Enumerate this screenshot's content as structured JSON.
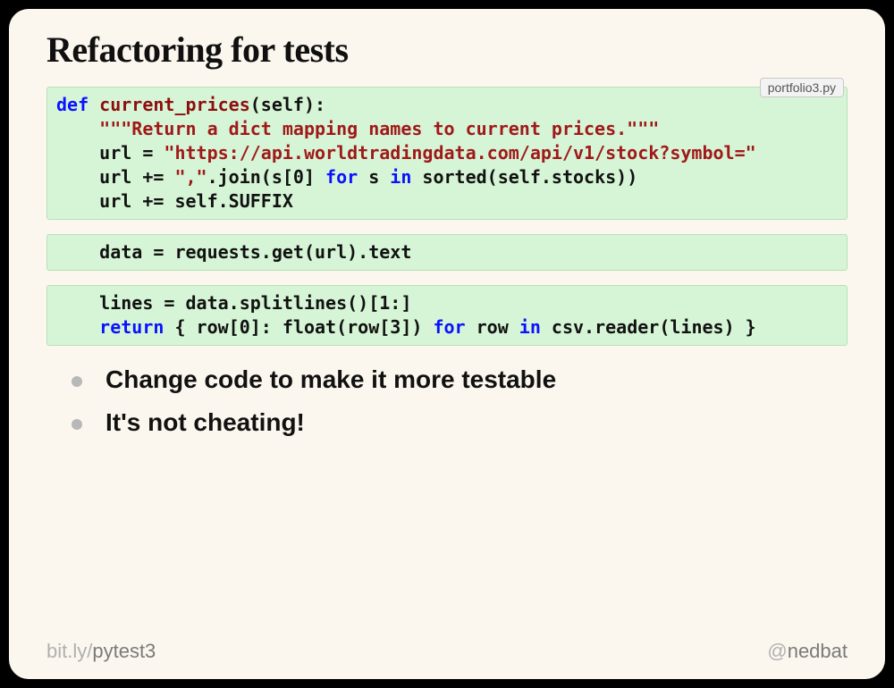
{
  "title": "Refactoring for tests",
  "file_badge": "portfolio3.py",
  "code": {
    "block1_html": "<span class=\"kw\">def</span> <span class=\"fn\">current_prices</span><span class=\"bold\">(self):</span>\n    <span class=\"str\">\"\"\"Return a dict mapping names to current prices.\"\"\"</span>\n    <span class=\"bold\">url = </span><span class=\"str\">\"https://api.worldtradingdata.com/api/v1/stock?symbol=\"</span>\n    <span class=\"bold\">url += </span><span class=\"str\">\",\"</span><span class=\"bold\">.join(s[0] </span><span class=\"kw\">for</span><span class=\"bold\"> s </span><span class=\"kw\">in</span><span class=\"bold\"> sorted(self.stocks))</span>\n    <span class=\"bold\">url += self.SUFFIX</span>",
    "block2_html": "    <span class=\"bold\">data = requests.get(url).text</span>",
    "block3_html": "    <span class=\"bold\">lines = data.splitlines()[1:]</span>\n    <span class=\"kw\">return</span><span class=\"bold\"> { row[0]: float(row[3]) </span><span class=\"kw\">for</span><span class=\"bold\"> row </span><span class=\"kw\">in</span><span class=\"bold\"> csv.reader(lines) }</span>"
  },
  "bullets": [
    "Change code to make it more testable",
    "It's not cheating!"
  ],
  "footer": {
    "left_prefix": "bit.ly/",
    "left_main": "pytest3",
    "right_prefix": "@",
    "right_main": "nedbat"
  }
}
